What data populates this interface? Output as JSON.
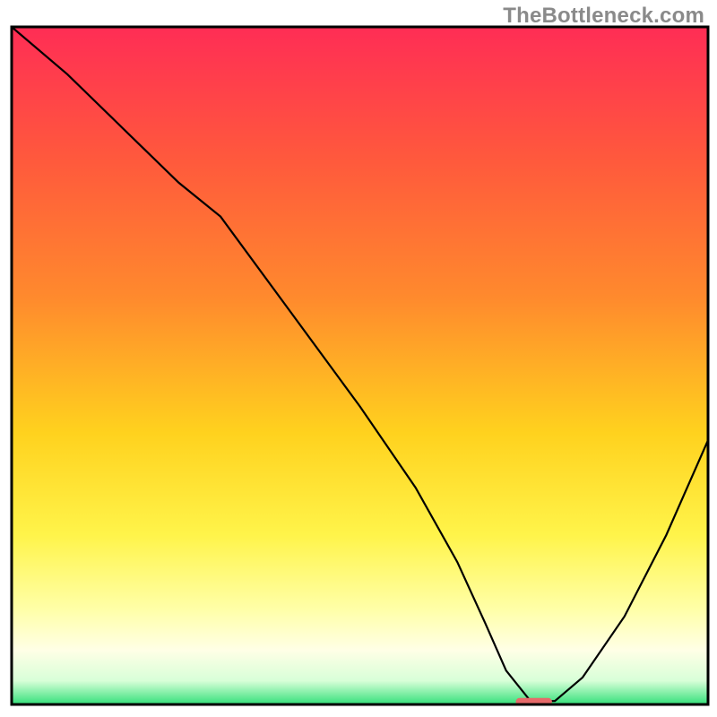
{
  "watermark": "TheBottleneck.com",
  "chart_data": {
    "type": "line",
    "title": "",
    "xlabel": "",
    "ylabel": "",
    "xlim": [
      0,
      100
    ],
    "ylim": [
      0,
      100
    ],
    "grid": false,
    "legend": false,
    "background_gradient_stops": [
      {
        "offset": 0.0,
        "color": "#ff2d55"
      },
      {
        "offset": 0.2,
        "color": "#ff5a3c"
      },
      {
        "offset": 0.4,
        "color": "#ff8a2d"
      },
      {
        "offset": 0.6,
        "color": "#ffd21e"
      },
      {
        "offset": 0.75,
        "color": "#fff44a"
      },
      {
        "offset": 0.86,
        "color": "#ffffa8"
      },
      {
        "offset": 0.92,
        "color": "#ffffe6"
      },
      {
        "offset": 0.965,
        "color": "#d8ffd8"
      },
      {
        "offset": 1.0,
        "color": "#34e07a"
      }
    ],
    "series": [
      {
        "name": "bottleneck-curve",
        "color": "#000000",
        "stroke_width": 2.2,
        "x": [
          0,
          8,
          16,
          24,
          30,
          40,
          50,
          58,
          64,
          68,
          71,
          74.5,
          78,
          82,
          88,
          94,
          100
        ],
        "y": [
          100,
          93,
          85,
          77,
          72,
          58,
          44,
          32,
          21,
          12,
          5,
          0.5,
          0.5,
          4,
          13,
          25,
          39
        ]
      }
    ],
    "marker": {
      "name": "optimal-pill",
      "color": "#e66a6a",
      "x_center": 75.0,
      "x_half_width": 2.6,
      "y": 0.4,
      "height": 1.1,
      "rx": 0.6
    },
    "annotations": []
  }
}
